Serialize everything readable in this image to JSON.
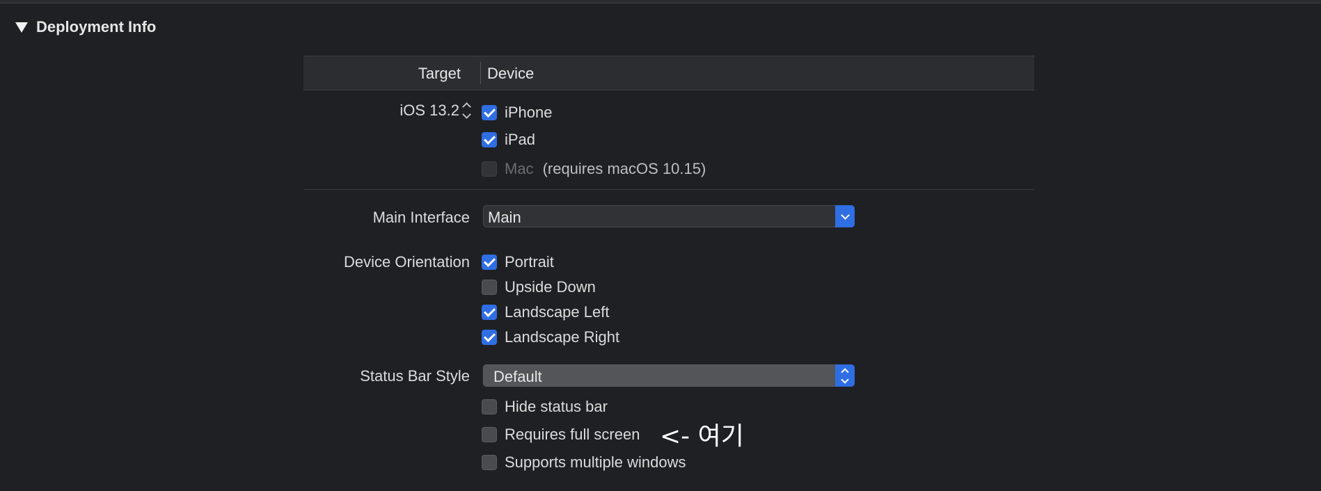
{
  "section": {
    "title": "Deployment Info"
  },
  "table": {
    "target_header": "Target",
    "device_header": "Device"
  },
  "target": {
    "ios_version": "iOS 13.2"
  },
  "devices": {
    "iphone": {
      "label": "iPhone",
      "checked": true
    },
    "ipad": {
      "label": "iPad",
      "checked": true
    },
    "mac": {
      "label": "Mac",
      "note": "(requires macOS 10.15)",
      "checked": false,
      "enabled": false
    }
  },
  "main_interface": {
    "label": "Main Interface",
    "value": "Main"
  },
  "orientation": {
    "label": "Device Orientation",
    "portrait": {
      "label": "Portrait",
      "checked": true
    },
    "upside_down": {
      "label": "Upside Down",
      "checked": false
    },
    "landscape_left": {
      "label": "Landscape Left",
      "checked": true
    },
    "landscape_right": {
      "label": "Landscape Right",
      "checked": true
    }
  },
  "status_bar": {
    "label": "Status Bar Style",
    "value": "Default",
    "hide": {
      "label": "Hide status bar",
      "checked": false
    },
    "full_screen": {
      "label": "Requires full screen",
      "checked": false
    },
    "multiple_windows": {
      "label": "Supports multiple windows",
      "checked": false
    }
  },
  "annotation": {
    "text": "<- 여기"
  },
  "colors": {
    "accent": "#2f6ee3",
    "background": "#1f2023"
  }
}
